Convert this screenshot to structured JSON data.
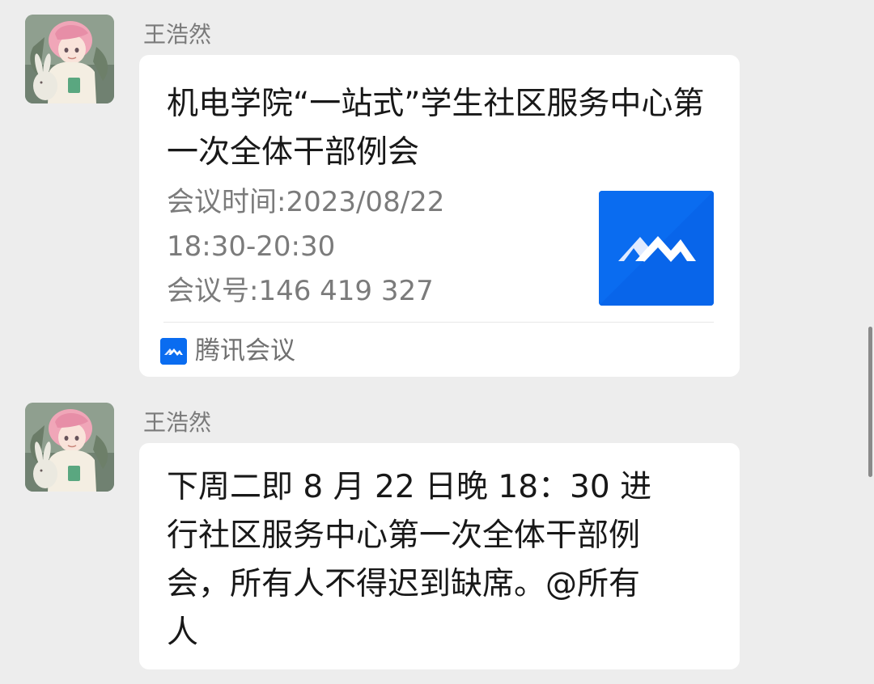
{
  "messages": [
    {
      "sender": "王浩然",
      "type": "meeting-card",
      "card": {
        "title": "机电学院“一站式”学生社区服务中心第一次全体干部例会",
        "details": [
          "会议时间:2023/08/22",
          "18:30-20:30",
          "会议号:146 419 327"
        ],
        "source": "腾讯会议"
      }
    },
    {
      "sender": "王浩然",
      "type": "text",
      "text": "下周二即 8 月 22 日晚 18：30 进\n行社区服务中心第一次全体干部例\n会，所有人不得迟到缺席。@所有\n人"
    }
  ],
  "colors": {
    "background": "#ededed",
    "bubble": "#ffffff",
    "accent": "#0a6cf0"
  },
  "icons": {
    "avatar": "avatar-image",
    "meeting_logo": "tencent-meeting-logo-icon"
  }
}
